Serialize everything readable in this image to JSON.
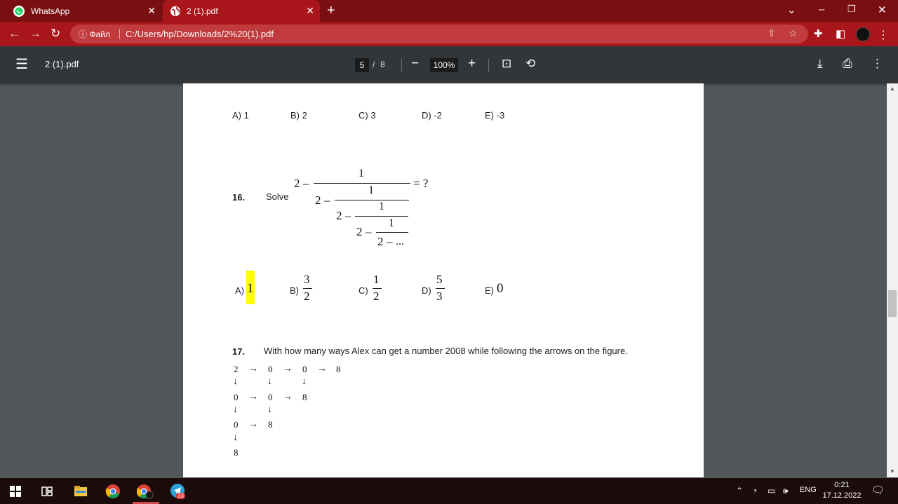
{
  "browser": {
    "tabs": [
      {
        "title": "WhatsApp",
        "icon": "whatsapp-icon"
      },
      {
        "title": "2 (1).pdf",
        "icon": "globe-icon"
      }
    ],
    "address": {
      "info_label": "ⓘ Файл",
      "url": "C:/Users/hp/Downloads/2%20(1).pdf"
    }
  },
  "pdf_toolbar": {
    "title": "2 (1).pdf",
    "current_page": "5",
    "page_sep": "/",
    "total_pages": "8",
    "zoom": "100%"
  },
  "document": {
    "q15_options": [
      "A) 1",
      "B) 2",
      "C) 3",
      "D) -2",
      "E) -3"
    ],
    "q16": {
      "number": "16.",
      "prompt": "Solve",
      "two": "2",
      "minus": "–",
      "one": "1",
      "ellipsis": "...",
      "equals_q": "= ?",
      "options": {
        "a_label": "A)",
        "a_value": "1",
        "b_label": "B)",
        "b_num": "3",
        "b_den": "2",
        "c_label": "C)",
        "c_num": "1",
        "c_den": "2",
        "d_label": "D)",
        "d_num": "5",
        "d_den": "3",
        "e_label": "E)",
        "e_value": "0"
      }
    },
    "q17": {
      "number": "17.",
      "text": "With how many ways Alex can get a number 2008 while following the arrows on the figure.",
      "grid": {
        "row1": [
          "2",
          "→",
          "0",
          "→",
          "0",
          "→",
          "8"
        ],
        "arrows1": [
          "↓",
          "↓",
          "↓"
        ],
        "row2": [
          "0",
          "→",
          "0",
          "→",
          "8"
        ],
        "arrows2": [
          "↓",
          "↓"
        ],
        "row3": [
          "0",
          "→",
          "8"
        ],
        "arrows3": [
          "↓"
        ],
        "row4": [
          "8"
        ]
      }
    }
  },
  "taskbar": {
    "apps": [
      "windows-start-icon",
      "task-view-icon",
      "file-explorer-icon",
      "chrome-icon",
      "chrome-profile-icon",
      "telegram-icon"
    ],
    "telegram_badge": "33",
    "language": "ENG",
    "time": "0:21",
    "date": "17.12.2022"
  },
  "colors": {
    "tabstrip": "#7a0f12",
    "toolbar": "#a8161b",
    "pdf_bar": "#323639",
    "viewer_bg": "#525659",
    "highlight": "#ffff00"
  }
}
